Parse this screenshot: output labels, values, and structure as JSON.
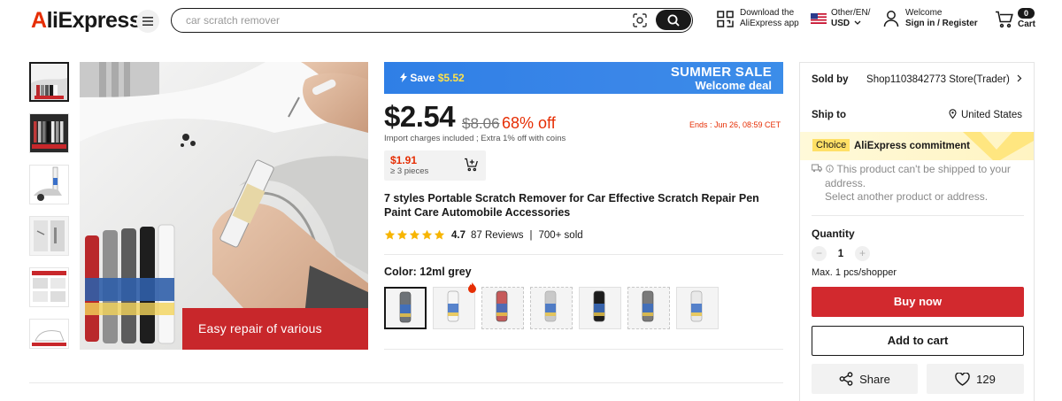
{
  "header": {
    "logo": "AliExpress",
    "search_placeholder": "car scratch remover",
    "download_line1": "Download the",
    "download_line2": "AliExpress app",
    "locale_line1": "Other/EN/",
    "locale_line2": "USD",
    "account_line1": "Welcome",
    "account_line2": "Sign in / Register",
    "cart_count": "0",
    "cart_label": "Cart"
  },
  "gallery": {
    "banner_text": "Easy repair of various scratches",
    "thumb_count": 6
  },
  "promo": {
    "save_prefix": "Save ",
    "save_amount": "$5.52",
    "sale_title": "SUMMER SALE",
    "sale_sub": "Welcome deal"
  },
  "pricing": {
    "price": "$2.54",
    "original_price": "$8.06",
    "discount": "68% off",
    "ends": "Ends :  Jun 26, 08:59 CET",
    "import_note": "Import charges included ; Extra 1% off with coins",
    "tier_price": "$1.91",
    "tier_qty": "≥ 3 pieces"
  },
  "product": {
    "title": "7 styles Portable Scratch Remover for Car Effective Scratch Repair Pen Paint Care Automobile Accessories",
    "rating": "4.7",
    "stars": 5,
    "reviews": "87 Reviews",
    "separator": "|",
    "sold": "700+ sold",
    "color_label": "Color: 12ml grey",
    "swatch_colors": [
      "#6d7277",
      "#f5f5f5",
      "#c65a5a",
      "#c9c9c9",
      "#1c1c1c",
      "#7a7a7a",
      "#e9e9e9"
    ]
  },
  "panel": {
    "sold_by_label": "Sold by",
    "sold_by_value": "Shop1103842773 Store(Trader)",
    "ship_to_label": "Ship to",
    "ship_to_value": "United States",
    "choice_badge": "Choice",
    "choice_text": "AliExpress commitment",
    "warn_line1": "This product can't be shipped to your",
    "warn_line2": "address.",
    "warn_line3": "Select another product or address.",
    "quantity_label": "Quantity",
    "minus": "−",
    "quantity_value": "1",
    "plus": "+",
    "max_note": "Max. 1 pcs/shopper",
    "buy_now": "Buy now",
    "add_to_cart": "Add to cart",
    "share": "Share",
    "wishlist_count": "129"
  },
  "colors": {
    "brand_red": "#e62e04",
    "buy_red": "#d2292e",
    "sale_blue": "#3a86e8",
    "star": "#f7b500"
  }
}
